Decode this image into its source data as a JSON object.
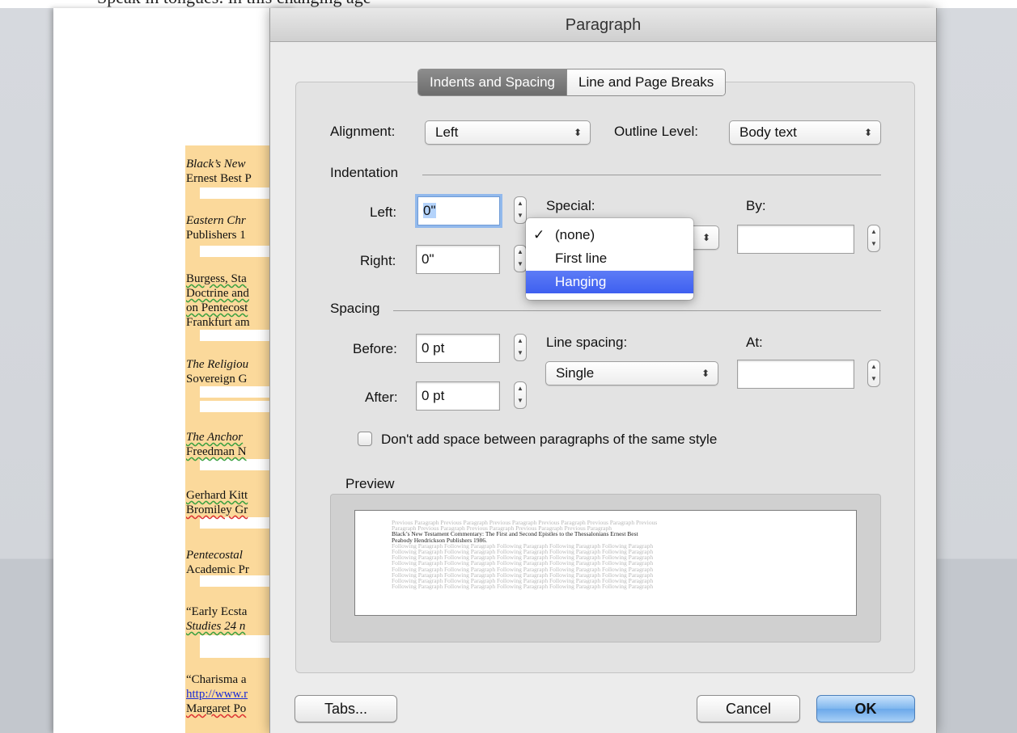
{
  "document": {
    "top_cutoff_text": "Speak in tongues: in this changing age",
    "lines": [
      {
        "text": "Black’s New",
        "style": "it"
      },
      {
        "text": "Ernest Best P",
        "style": ""
      },
      {
        "text": "Eastern Chr",
        "style": "it"
      },
      {
        "text": "Publishers 1",
        "style": ""
      },
      {
        "text": "Burgess, Sta",
        "style": "sq"
      },
      {
        "text": "Doctrine and",
        "style": "sq"
      },
      {
        "text": "on Pentecost",
        "style": "sq"
      },
      {
        "text": "Frankfurt am",
        "style": ""
      },
      {
        "text": "The Religiou",
        "style": "it"
      },
      {
        "text": "Sovereign G",
        "style": ""
      },
      {
        "text": "The Anchor",
        "style": "it sq"
      },
      {
        "text": "Freedman N",
        "style": "sq"
      },
      {
        "text": "Gerhard Kitt",
        "style": "sq"
      },
      {
        "text": "Bromiley Gr",
        "style": "sqr"
      },
      {
        "text": "Pentecostal",
        "style": "it"
      },
      {
        "text": "Academic Pr",
        "style": ""
      },
      {
        "text": "“Early Ecsta",
        "style": ""
      },
      {
        "text": "Studies 24 n",
        "style": "it sq"
      },
      {
        "text": " “Charisma a",
        "style": ""
      },
      {
        "text": "http://www.r",
        "style": "link"
      },
      {
        "text": "Margaret Po",
        "style": "sqr"
      }
    ]
  },
  "dialog": {
    "title": "Paragraph",
    "tabs": [
      {
        "label": "Indents and Spacing",
        "active": true
      },
      {
        "label": "Line and Page Breaks",
        "active": false
      }
    ],
    "alignment": {
      "label": "Alignment:",
      "value": "Left"
    },
    "outline_level": {
      "label": "Outline Level:",
      "value": "Body text"
    },
    "indentation": {
      "heading": "Indentation",
      "left": {
        "label": "Left:",
        "value": "0\""
      },
      "right": {
        "label": "Right:",
        "value": "0\""
      },
      "special": {
        "label": "Special:"
      },
      "by": {
        "label": "By:",
        "value": ""
      }
    },
    "special_menu": {
      "items": [
        {
          "label": "(none)",
          "checked": "✓"
        },
        {
          "label": "First line",
          "checked": ""
        },
        {
          "label": "Hanging",
          "checked": ""
        }
      ],
      "highlighted": "Hanging"
    },
    "spacing": {
      "heading": "Spacing",
      "before": {
        "label": "Before:",
        "value": "0 pt"
      },
      "after": {
        "label": "After:",
        "value": "0 pt"
      },
      "line_spacing": {
        "label": "Line spacing:",
        "value": "Single"
      },
      "at": {
        "label": "At:",
        "value": ""
      }
    },
    "dont_add_space": {
      "label": "Don't add space between paragraphs of the same style",
      "checked": false
    },
    "preview": {
      "heading": "Preview",
      "previous_line_1": "Previous Paragraph Previous Paragraph Previous Paragraph Previous Paragraph Previous Paragraph Previous",
      "previous_line_2": "Paragraph Previous Paragraph Previous Paragraph Previous Paragraph Previous Paragraph",
      "current_line_1": "Black’s New Testament Commentary: The First and Second Epistles to the Thessalonians Ernest Best",
      "current_line_2": "Peabody Hendrickson Publishers 1986.",
      "following_line": "Following Paragraph Following Paragraph Following Paragraph Following Paragraph Following Paragraph"
    },
    "buttons": {
      "tabs": "Tabs...",
      "cancel": "Cancel",
      "ok": "OK"
    },
    "stepper_glyph": {
      "up": "▲",
      "down": "▼"
    },
    "popup_arrows": "⬍"
  }
}
